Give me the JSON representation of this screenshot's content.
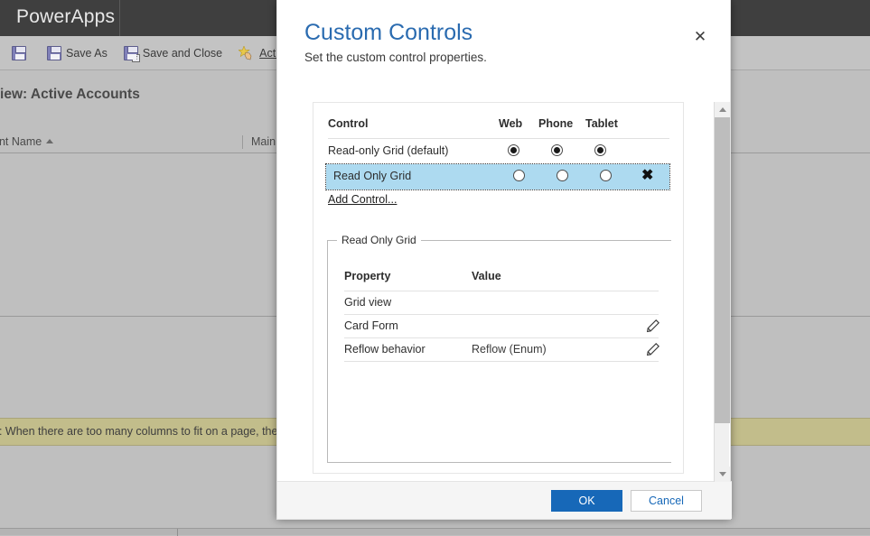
{
  "background": {
    "brand": "PowerApps",
    "ribbon": [
      {
        "label": "",
        "icon": "save-icon"
      },
      {
        "label": "Save As",
        "icon": "save-as-icon"
      },
      {
        "label": "Save and Close",
        "icon": "save-and-close-icon"
      },
      {
        "label": "Actions",
        "icon": "actions-icon",
        "has_caret": true
      }
    ],
    "view_title": "View: Active Accounts",
    "grid_columns": [
      {
        "label": "unt Name",
        "sorted": "asc"
      },
      {
        "label": "Main"
      }
    ],
    "notification": "e: When there are too many columns to fit on a page, the view",
    "notification_color": "#c2bd8b"
  },
  "dialog": {
    "title": "Custom Controls",
    "subtitle": "Set the custom control properties.",
    "title_color": "#2a6bb0",
    "close_icon": "✕",
    "controls_table": {
      "columns": [
        "Control",
        "Web",
        "Phone",
        "Tablet"
      ],
      "rows": [
        {
          "name": "Read-only Grid (default)",
          "web": true,
          "phone": true,
          "tablet": true,
          "selected": false,
          "deletable": false
        },
        {
          "name": "Read Only Grid",
          "web": false,
          "phone": false,
          "tablet": false,
          "selected": true,
          "deletable": true,
          "delete_icon": "✖"
        }
      ],
      "add_link": "Add Control..."
    },
    "properties_panel": {
      "legend": "Read Only Grid",
      "columns": [
        "Property",
        "Value"
      ],
      "rows": [
        {
          "property": "Grid view",
          "value": "",
          "editable": false
        },
        {
          "property": "Card Form",
          "value": "",
          "editable": true
        },
        {
          "property": "Reflow behavior",
          "value": "Reflow (Enum)",
          "editable": true
        }
      ]
    },
    "footer": {
      "ok_label": "OK",
      "cancel_label": "Cancel",
      "ok_color": "#1768b8"
    },
    "scrollbar": {
      "up_icon": "chevron-up",
      "down_icon": "chevron-down"
    }
  }
}
